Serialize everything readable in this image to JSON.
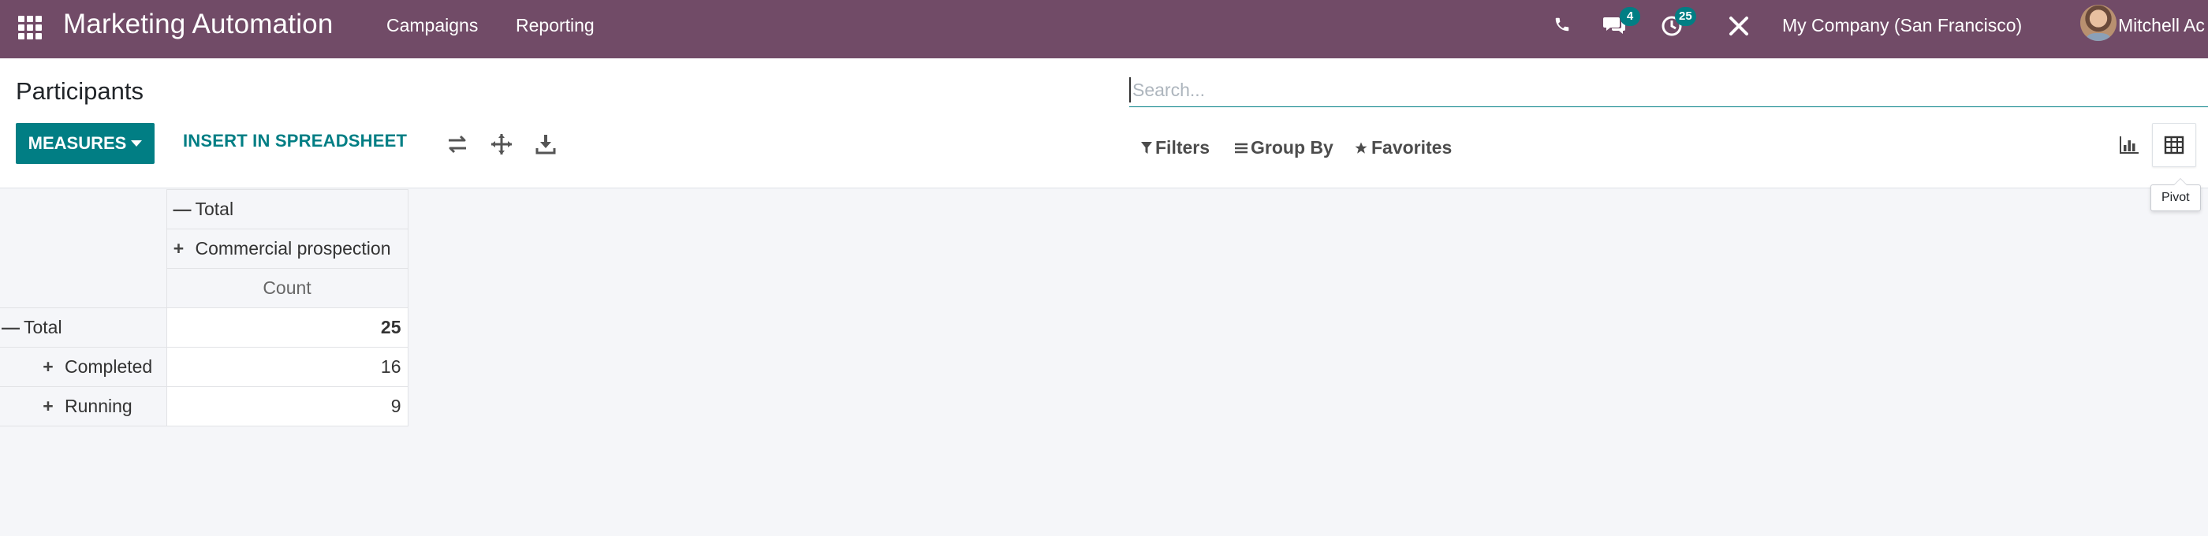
{
  "navbar": {
    "app_title": "Marketing Automation",
    "menu": [
      "Campaigns",
      "Reporting"
    ],
    "messages_count": "4",
    "activities_count": "25",
    "company": "My Company (San Francisco)",
    "user": "Mitchell Ac"
  },
  "control_panel": {
    "breadcrumb": "Participants",
    "measures_label": "MEASURES",
    "insert_label": "INSERT IN SPREADSHEET",
    "search_placeholder": "Search...",
    "filters_label": "Filters",
    "groupby_label": "Group By",
    "favorites_label": "Favorites",
    "tooltip": "Pivot"
  },
  "pivot": {
    "col_total": "Total",
    "col_group": "Commercial prospection",
    "measure": "Count",
    "rows": [
      {
        "label": "Total",
        "value": "25"
      },
      {
        "label": "Completed",
        "value": "16"
      },
      {
        "label": "Running",
        "value": "9"
      }
    ]
  },
  "colors": {
    "navbar": "#714b67",
    "primary": "#017e84",
    "background": "#f5f6f9"
  }
}
